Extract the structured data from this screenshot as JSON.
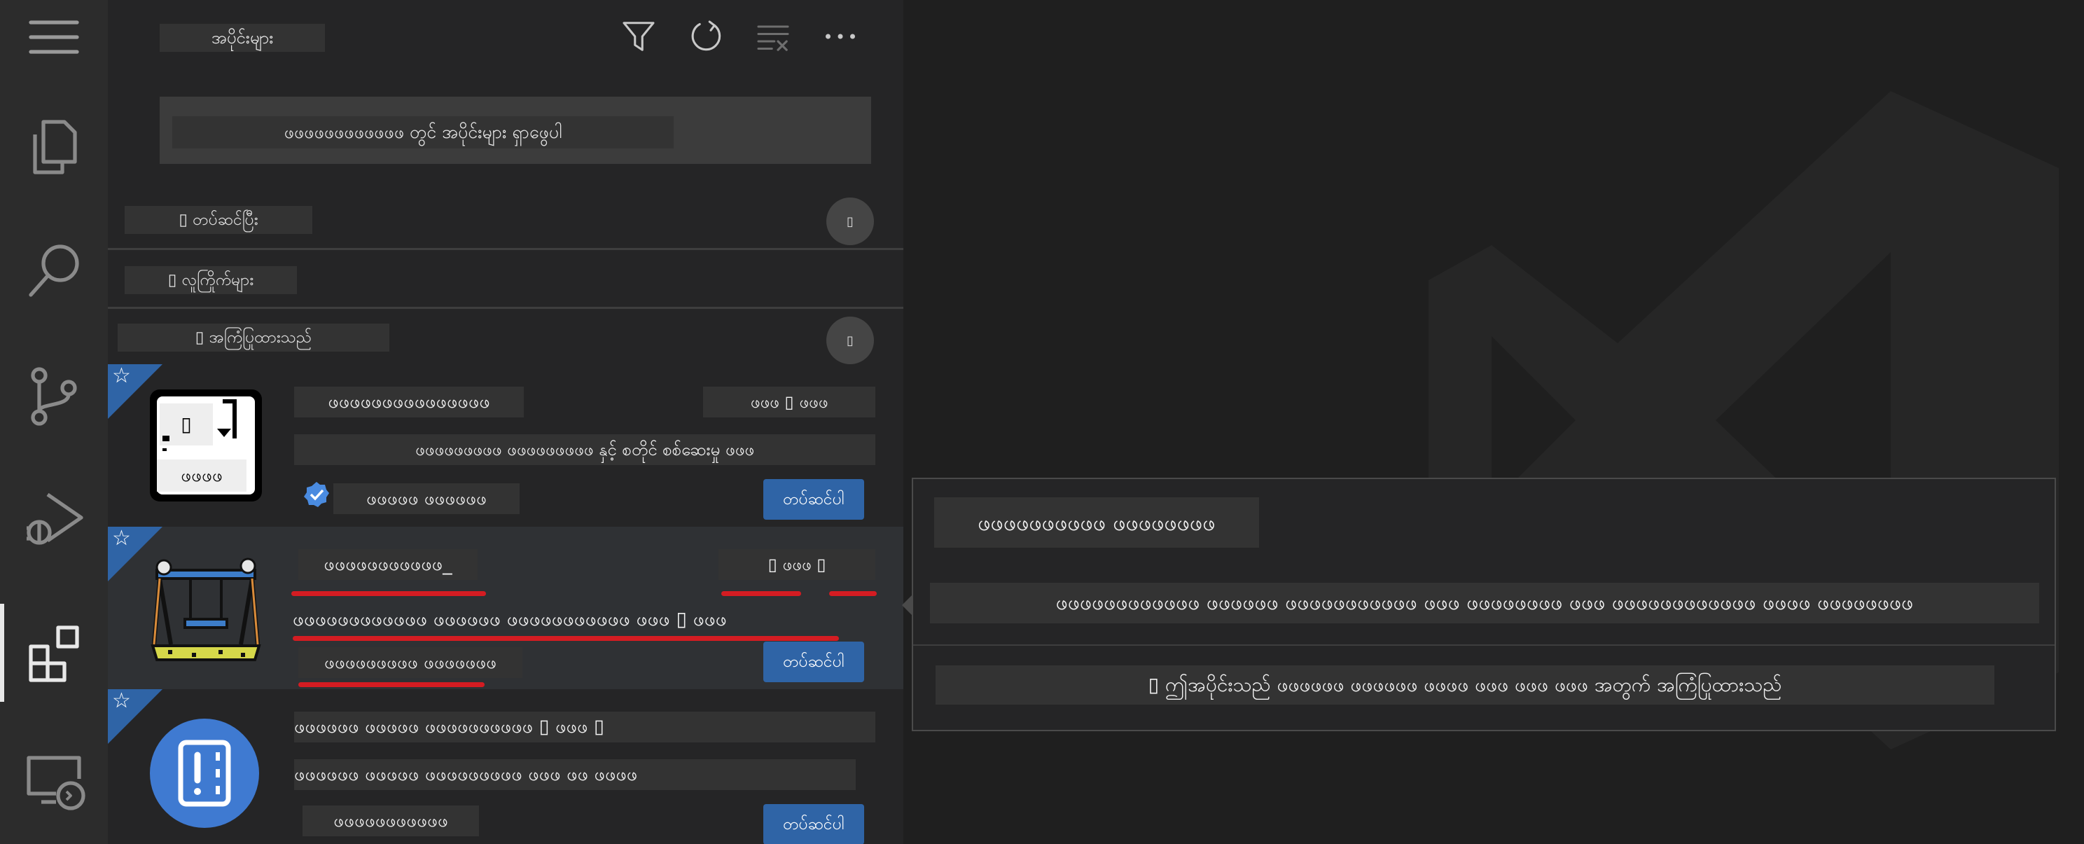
{
  "activity_bar": {
    "items": [
      {
        "name": "menu-icon"
      },
      {
        "name": "explorer-icon"
      },
      {
        "name": "search-icon"
      },
      {
        "name": "source-control-icon"
      },
      {
        "name": "run-debug-icon"
      },
      {
        "name": "extensions-icon",
        "active": true
      },
      {
        "name": "remote-explorer-icon"
      }
    ]
  },
  "sidebar": {
    "title": "အပိုင်းများ",
    "header_icons": [
      "filter-icon",
      "refresh-icon",
      "clear-icon",
      "more-icon"
    ],
    "search": {
      "placeholder": "ဖဖဖဖဖဖဖဖဖဖဖဖ တွင် အပိုင်းများ ရှာဖွေပါ"
    },
    "sections": {
      "installed": {
        "label": "▯ တပ်ဆင်ပြီး",
        "badge": "▯"
      },
      "popular": {
        "label": "▯ လူကြိုက်များ"
      },
      "recommended": {
        "label": "▯ အကြံပြုထားသည်",
        "badge": "▯"
      }
    },
    "extensions": [
      {
        "name": "ဖဖဖဖဖဖဖဖဖဖဖဖဖဖဖ",
        "stats": "ဖဖဖ ▯ ဖဖဖ",
        "description": "ဖဖဖဖဖဖဖဖဖ ဖဖဖဖဖဖဖဖဖ နှင့် စတိုင် စစ်ဆေးမှု ဖဖဖ",
        "publisher": "ဖဖဖဖဖ ဖဖဖဖဖဖ",
        "icon_label_top": "▯",
        "icon_label_bottom": "ဖဖဖဖ",
        "install_label": "တပ်ဆင်ပါ"
      },
      {
        "name": "ဖဖဖဖဖဖဖဖဖဖဖ_",
        "stats": "▯ ဖဖဖ ▯",
        "description": "ဖဖဖဖဖဖဖဖဖဖဖဖ ဖဖဖဖဖဖ ဖဖဖဖဖဖဖဖဖဖဖ ဖဖဖ ▯ ဖဖဖ",
        "publisher": "ဖဖဖဖဖဖဖဖဖ ဖဖဖဖဖဖဖ",
        "install_label": "တပ်ဆင်ပါ"
      },
      {
        "name": "ဖဖဖဖဖဖ ဖဖဖဖဖ ဖဖဖဖဖဖဖဖဖဖ ▯ ဖဖဖ ▯",
        "description": "ဖဖဖဖဖဖ ဖဖဖဖဖ ဖဖဖဖဖဖဖဖဖ ဖဖဖ ဖဖ ဖဖဖဖ",
        "publisher": "ဖဖဖဖဖဖဖဖဖဖဖ",
        "install_label": "တပ်ဆင်ပါ"
      }
    ]
  },
  "tooltip": {
    "title": "ဖဖဖဖဖဖဖဖဖဖ ဖဖဖဖဖဖဖဖ",
    "description": "ဖဖဖဖဖဖဖဖဖဖဖဖ ဖဖဖဖဖဖ ဖဖဖဖဖဖဖဖဖဖဖ ဖဖဖ ဖဖဖဖဖဖဖဖ ဖဖဖ ဖဖဖဖဖဖဖဖဖဖဖဖ ဖဖဖဖ ဖဖဖဖဖဖဖဖ",
    "reason": "▯ ဤအပိုင်းသည် ဖဖဖဖဖဖ ဖဖဖဖဖဖ ဖဖဖဖ ဖဖဖ ဖဖဖ ဖဖဖ အတွက် အကြံပြုထားသည်"
  },
  "colors": {
    "accent": "#2f64a6",
    "highlight_underline": "#d41c22",
    "sidebar_bg": "#252526",
    "activity_bg": "#2c2c2c",
    "editor_bg": "#1f1f1f"
  }
}
